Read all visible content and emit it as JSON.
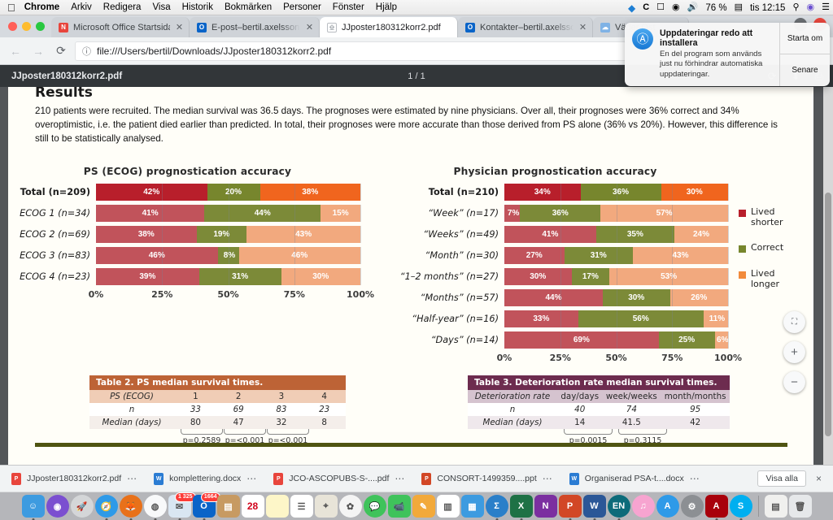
{
  "menubar": {
    "apple": "apple-logo",
    "items": [
      {
        "label": "Chrome",
        "bold": true
      },
      {
        "label": "Arkiv",
        "bold": false
      },
      {
        "label": "Redigera",
        "bold": false
      },
      {
        "label": "Visa",
        "bold": false
      },
      {
        "label": "Historik",
        "bold": false
      },
      {
        "label": "Bokmärken",
        "bold": false
      },
      {
        "label": "Personer",
        "bold": false
      },
      {
        "label": "Fönster",
        "bold": false
      },
      {
        "label": "Hjälp",
        "bold": false
      }
    ],
    "status": {
      "dropbox": "▼",
      "caffeine": "C",
      "airplay": "airplay-icon",
      "wifi": "wifi-icon",
      "volume": "volume-icon",
      "battery_percent": "76 %",
      "battery": "battery-icon",
      "time": "tis 12:15",
      "search": "search-icon",
      "siri": "siri-icon",
      "controlcenter": "list-icon"
    }
  },
  "notification": {
    "title": "Uppdateringar redo att installera",
    "body": "En del program som används just nu förhindrar automatiska uppdateringar.",
    "icon": "app-store-icon",
    "primary_button": "Starta om",
    "secondary_button": "Senare"
  },
  "browser": {
    "tabs": [
      {
        "title": "Microsoft Office Startsida",
        "favicon": "office-icon",
        "active": false,
        "truncated": false
      },
      {
        "title": "E-post–bertil.axelsson@region",
        "favicon": "outlook-icon",
        "active": false,
        "truncated": true
      },
      {
        "title": "JJposter180312korr2.pdf",
        "favicon": "pdf-icon",
        "active": true,
        "truncated": false
      },
      {
        "title": "Kontakter–bertil.axelsson@reg",
        "favicon": "outlook-icon",
        "active": false,
        "truncated": true
      },
      {
        "title": "Väder Öst",
        "favicon": "weather-icon",
        "active": false,
        "truncated": true
      }
    ],
    "nav": {
      "back": "back-arrow-icon",
      "forward": "forward-arrow-icon",
      "reload": "reload-icon"
    },
    "omnibox": {
      "info_icon": "info-circle-icon",
      "url": "file:///Users/bertil/Downloads/JJposter180312korr2.pdf"
    }
  },
  "pdf_viewer": {
    "filename": "JJposter180312korr2.pdf",
    "page_indicator": "1 / 1",
    "actions": {
      "rotate": "rotate-icon",
      "download": "download-icon",
      "print": "print-icon"
    },
    "zoom_controls": {
      "fit": "fit-to-page-icon",
      "zoom_in": "+",
      "zoom_out": "−"
    }
  },
  "poster": {
    "section_heading": "Results",
    "paragraph": "210 patients were recruited. The median survival was 36.5 days. The prognoses were estimated by nine physicians. Over all, their prognoses were 36% correct and 34% overoptimistic, i.e. the patient died earlier than predicted. In total, their prognoses were more accurate than those derived from PS alone (36% vs 20%). However, this difference is still to be statistically analysed.",
    "legend": [
      {
        "label": "Lived shorter",
        "color": "#b81f2b"
      },
      {
        "label": "Correct",
        "color": "#77862d"
      },
      {
        "label": "Lived longer",
        "color": "#f28b3c"
      }
    ],
    "table2": {
      "title": "Table 2. PS median survival times.",
      "header_color": "#bd6336",
      "rows": [
        {
          "label": "PS (ECOG)",
          "values": [
            "1",
            "2",
            "3",
            "4"
          ]
        },
        {
          "label": "n",
          "values": [
            "33",
            "69",
            "83",
            "23"
          ]
        },
        {
          "label": "Median (days)",
          "values": [
            "80",
            "47",
            "32",
            "8"
          ]
        }
      ],
      "pvalues": [
        "p=0.2589",
        "p=<0.001",
        "p=<0.001"
      ]
    },
    "table3": {
      "title": "Table 3. Deterioration rate median survival times.",
      "header_color": "#6d2c4f",
      "rows": [
        {
          "label": "Deterioration rate",
          "values": [
            "day/days",
            "week/weeks",
            "month/months"
          ]
        },
        {
          "label": "n",
          "values": [
            "40",
            "74",
            "95"
          ]
        },
        {
          "label": "Median (days)",
          "values": [
            "14",
            "41.5",
            "42"
          ]
        }
      ],
      "pvalues": [
        "p=0.0015",
        "p=0.3115"
      ]
    }
  },
  "chart_data": [
    {
      "type": "bar",
      "subtype": "stacked-horizontal-100",
      "title": "PS (ECOG) prognostication accuracy",
      "xlabel": "",
      "ylabel": "",
      "xlim": [
        0,
        100
      ],
      "ticks": [
        "0%",
        "25%",
        "50%",
        "75%",
        "100%"
      ],
      "tick_values": [
        0,
        25,
        50,
        75,
        100
      ],
      "grid": true,
      "legend_position": "right",
      "series": [
        {
          "name": "Lived shorter",
          "values": [
            42,
            41,
            38,
            46,
            39
          ]
        },
        {
          "name": "Correct",
          "values": [
            20,
            44,
            19,
            8,
            31
          ]
        },
        {
          "name": "Lived longer",
          "values": [
            38,
            15,
            43,
            46,
            30
          ]
        }
      ],
      "categories": [
        "Total (n=209)",
        "ECOG 1 (n=34)",
        "ECOG 2 (n=69)",
        "ECOG 3 (n=83)",
        "ECOG 4 (n=23)"
      ],
      "category_labels": [
        {
          "main": "Total",
          "paren": "(n=209)",
          "emphasis": true
        },
        {
          "main": "ECOG 1",
          "paren": "(n=34)",
          "emphasis": false
        },
        {
          "main": "ECOG 2",
          "paren": "(n=69)",
          "emphasis": false
        },
        {
          "main": "ECOG 3",
          "paren": "(n=83)",
          "emphasis": false
        },
        {
          "main": "ECOG 4",
          "paren": "(n=23)",
          "emphasis": false
        }
      ],
      "data_labels": [
        [
          "42%",
          "20%",
          "38%"
        ],
        [
          "41%",
          "44%",
          "15%"
        ],
        [
          "38%",
          "19%",
          "43%"
        ],
        [
          "46%",
          "8%",
          "46%"
        ],
        [
          "39%",
          "31%",
          "30%"
        ]
      ],
      "row_colors": [
        [
          "#b81f2b",
          "#77862d",
          "#f0651e"
        ],
        [
          "#c1535b",
          "#7c8a38",
          "#f2a97e"
        ],
        [
          "#c1535b",
          "#7c8a38",
          "#f2a97e"
        ],
        [
          "#c1535b",
          "#7c8a38",
          "#f2a97e"
        ],
        [
          "#c1535b",
          "#7c8a38",
          "#f2a97e"
        ]
      ]
    },
    {
      "type": "bar",
      "subtype": "stacked-horizontal-100",
      "title": "Physician prognostication accuracy",
      "xlabel": "",
      "ylabel": "",
      "xlim": [
        0,
        100
      ],
      "ticks": [
        "0%",
        "25%",
        "50%",
        "75%",
        "100%"
      ],
      "tick_values": [
        0,
        25,
        50,
        75,
        100
      ],
      "grid": true,
      "legend_position": "right",
      "series": [
        {
          "name": "Lived shorter",
          "values": [
            34,
            7,
            41,
            27,
            30,
            44,
            33,
            69
          ]
        },
        {
          "name": "Correct",
          "values": [
            36,
            36,
            35,
            31,
            17,
            30,
            56,
            25
          ]
        },
        {
          "name": "Lived longer",
          "values": [
            30,
            57,
            24,
            43,
            53,
            26,
            11,
            6
          ]
        }
      ],
      "categories": [
        "Total (n=210)",
        "“Week” (n=17)",
        "“Weeks” (n=49)",
        "“Month” (n=30)",
        "“1–2 months” (n=27)",
        "“Months” (n=57)",
        "“Half-year” (n=16)",
        "“Days” (n=14)"
      ],
      "category_labels": [
        {
          "main": "Total",
          "paren": "(n=210)",
          "emphasis": true
        },
        {
          "main": "“Week”",
          "paren": "(n=17)",
          "emphasis": false
        },
        {
          "main": "“Weeks”",
          "paren": "(n=49)",
          "emphasis": false
        },
        {
          "main": "“Month”",
          "paren": "(n=30)",
          "emphasis": false
        },
        {
          "main": "“1–2 months”",
          "paren": "(n=27)",
          "emphasis": false
        },
        {
          "main": "“Months”",
          "paren": "(n=57)",
          "emphasis": false
        },
        {
          "main": "“Half-year”",
          "paren": "(n=16)",
          "emphasis": false
        },
        {
          "main": "“Days”",
          "paren": "(n=14)",
          "emphasis": false
        }
      ],
      "data_labels": [
        [
          "34%",
          "36%",
          "30%"
        ],
        [
          "7%",
          "36%",
          "57%"
        ],
        [
          "41%",
          "35%",
          "24%"
        ],
        [
          "27%",
          "31%",
          "43%"
        ],
        [
          "30%",
          "17%",
          "53%"
        ],
        [
          "44%",
          "30%",
          "26%"
        ],
        [
          "33%",
          "56%",
          "11%"
        ],
        [
          "69%",
          "25%",
          "6%"
        ]
      ],
      "row_colors": [
        [
          "#b81f2b",
          "#77862d",
          "#f0651e"
        ],
        [
          "#c1535b",
          "#7c8a38",
          "#f2a97e"
        ],
        [
          "#c1535b",
          "#7c8a38",
          "#f2a97e"
        ],
        [
          "#c1535b",
          "#7c8a38",
          "#f2a97e"
        ],
        [
          "#c1535b",
          "#7c8a38",
          "#f2a97e"
        ],
        [
          "#c1535b",
          "#7c8a38",
          "#f2a97e"
        ],
        [
          "#c1535b",
          "#7c8a38",
          "#f2a97e"
        ],
        [
          "#c1535b",
          "#7c8a38",
          "#f2a97e"
        ]
      ]
    }
  ],
  "downloads_shelf": {
    "items": [
      {
        "name": "JJposter180312korr2.pdf",
        "type": "pdf"
      },
      {
        "name": "komplettering.docx",
        "type": "doc"
      },
      {
        "name": "JCO-ASCOPUBS-S-....pdf",
        "type": "pdf"
      },
      {
        "name": "CONSORT-1499359....ppt",
        "type": "ppt"
      },
      {
        "name": "Organiserad PSA-t....docx",
        "type": "doc"
      }
    ],
    "show_all": "Visa alla",
    "close": "×"
  },
  "dock": {
    "items": [
      {
        "name": "finder",
        "glyph": "☺",
        "bg": "#3d9be0",
        "round": false,
        "running": true,
        "badge": ""
      },
      {
        "name": "siri",
        "glyph": "◉",
        "bg": "#7b4fd0",
        "round": true,
        "running": false,
        "badge": ""
      },
      {
        "name": "launchpad",
        "glyph": "🚀",
        "bg": "#d4d6d8",
        "round": true,
        "running": false,
        "badge": ""
      },
      {
        "name": "safari",
        "glyph": "🧭",
        "bg": "#2e9ae8",
        "round": true,
        "running": true,
        "badge": ""
      },
      {
        "name": "firefox",
        "glyph": "🦊",
        "bg": "#e8711a",
        "round": true,
        "running": true,
        "badge": ""
      },
      {
        "name": "chrome",
        "glyph": "◍",
        "bg": "#f8f9fa",
        "round": true,
        "running": true,
        "badge": ""
      },
      {
        "name": "mail",
        "glyph": "✉",
        "bg": "#d9e6f2",
        "round": false,
        "running": true,
        "badge": "1 325"
      },
      {
        "name": "outlook",
        "glyph": "O",
        "bg": "#0a64c8",
        "round": false,
        "running": true,
        "badge": "1664"
      },
      {
        "name": "contacts",
        "glyph": "▤",
        "bg": "#c79a62",
        "round": false,
        "running": false,
        "badge": ""
      },
      {
        "name": "calendar",
        "glyph": "28",
        "bg": "#ffffff",
        "round": false,
        "running": false,
        "badge": ""
      },
      {
        "name": "notes",
        "glyph": "",
        "bg": "#fdf6c8",
        "round": false,
        "running": false,
        "badge": ""
      },
      {
        "name": "reminders",
        "glyph": "☰",
        "bg": "#ffffff",
        "round": false,
        "running": false,
        "badge": ""
      },
      {
        "name": "maps",
        "glyph": "⌖",
        "bg": "#e8e4d8",
        "round": false,
        "running": false,
        "badge": ""
      },
      {
        "name": "photos",
        "glyph": "✿",
        "bg": "#f4f4f4",
        "round": true,
        "running": false,
        "badge": ""
      },
      {
        "name": "messages",
        "glyph": "💬",
        "bg": "#3fc35b",
        "round": true,
        "running": false,
        "badge": ""
      },
      {
        "name": "facetime",
        "glyph": "📹",
        "bg": "#3fc35b",
        "round": false,
        "running": false,
        "badge": ""
      },
      {
        "name": "pages",
        "glyph": "✎",
        "bg": "#f2a93b",
        "round": false,
        "running": false,
        "badge": ""
      },
      {
        "name": "numbers",
        "glyph": "▥",
        "bg": "#ffffff",
        "round": false,
        "running": false,
        "badge": ""
      },
      {
        "name": "keynote",
        "glyph": "▦",
        "bg": "#3d9be0",
        "round": false,
        "running": false,
        "badge": ""
      },
      {
        "name": "spss",
        "glyph": "Σ",
        "bg": "#2a7fc9",
        "round": true,
        "running": true,
        "badge": ""
      },
      {
        "name": "excel",
        "glyph": "X",
        "bg": "#1e7145",
        "round": false,
        "running": true,
        "badge": ""
      },
      {
        "name": "onenote",
        "glyph": "N",
        "bg": "#7b2fa0",
        "round": false,
        "running": false,
        "badge": ""
      },
      {
        "name": "powerpoint",
        "glyph": "P",
        "bg": "#d24726",
        "round": false,
        "running": true,
        "badge": ""
      },
      {
        "name": "word",
        "glyph": "W",
        "bg": "#2b5797",
        "round": false,
        "running": true,
        "badge": ""
      },
      {
        "name": "endnote",
        "glyph": "EN",
        "bg": "#0c6b7a",
        "round": true,
        "running": true,
        "badge": ""
      },
      {
        "name": "itunes",
        "glyph": "♫",
        "bg": "#f7a4d0",
        "round": true,
        "running": false,
        "badge": ""
      },
      {
        "name": "app-store",
        "glyph": "A",
        "bg": "#2e9ae8",
        "round": true,
        "running": false,
        "badge": ""
      },
      {
        "name": "system-preferences",
        "glyph": "⚙",
        "bg": "#8c8f93",
        "round": true,
        "running": false,
        "badge": ""
      },
      {
        "name": "acrobat",
        "glyph": "A",
        "bg": "#a8000b",
        "round": false,
        "running": true,
        "badge": ""
      },
      {
        "name": "skype",
        "glyph": "S",
        "bg": "#00aff0",
        "round": true,
        "running": true,
        "badge": ""
      },
      {
        "name": "downloads-stack",
        "glyph": "▤",
        "bg": "#f0f0ee",
        "round": false,
        "running": false,
        "badge": ""
      },
      {
        "name": "trash",
        "glyph": "🗑",
        "bg": "#e6e8ea",
        "round": false,
        "running": false,
        "badge": ""
      }
    ]
  }
}
